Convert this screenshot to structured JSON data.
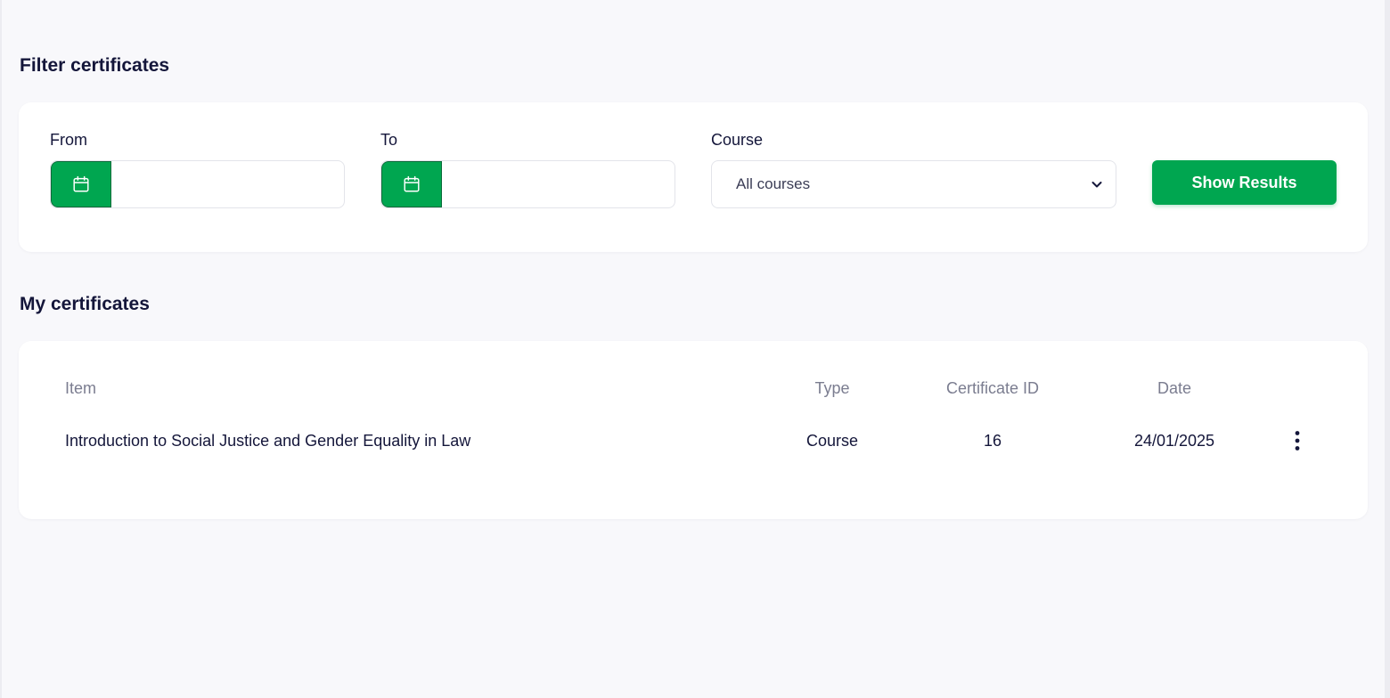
{
  "filter": {
    "title": "Filter certificates",
    "from_label": "From",
    "from_value": "",
    "to_label": "To",
    "to_value": "",
    "course_label": "Course",
    "course_selected": "All courses",
    "show_button": "Show Results"
  },
  "certificates": {
    "title": "My certificates",
    "columns": [
      "Item",
      "Type",
      "Certificate ID",
      "Date"
    ],
    "rows": [
      {
        "item": "Introduction to Social Justice and Gender Equality in Law",
        "type": "Course",
        "certificate_id": "16",
        "date": "24/01/2025"
      }
    ]
  },
  "icons": {
    "calendar": "calendar-icon",
    "dropdown": "chevron-down-icon",
    "row_menu": "more-vertical-icon"
  },
  "colors": {
    "accent": "#00a650",
    "text": "#14163a",
    "muted": "#7b7d90",
    "background": "#f8f8fb"
  }
}
